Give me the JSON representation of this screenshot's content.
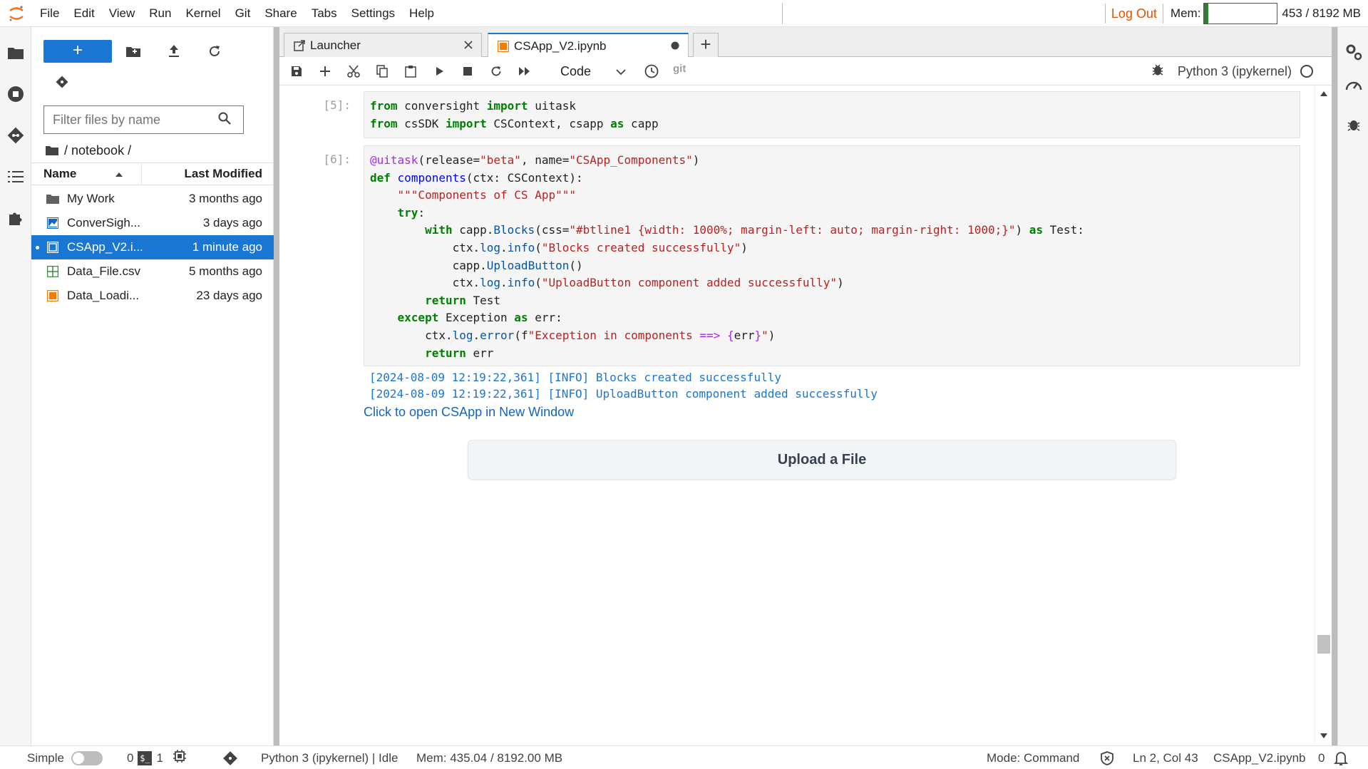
{
  "menubar": {
    "items": [
      "File",
      "Edit",
      "View",
      "Run",
      "Kernel",
      "Git",
      "Share",
      "Tabs",
      "Settings",
      "Help"
    ],
    "logout_label": "Log Out",
    "mem_label": "Mem:",
    "mem_text": "453 / 8192 MB",
    "mem_fraction": 0.055,
    "accent_color": "#e65100"
  },
  "filebrowser": {
    "new_button_label": "+",
    "filter_placeholder": "Filter files by name",
    "breadcrumb": "/ notebook /",
    "col_name": "Name",
    "col_modified": "Last Modified",
    "files": [
      {
        "name": "My Work",
        "modified": "3 months ago",
        "icon": "folder-icon",
        "selected": false
      },
      {
        "name": "ConverSigh...",
        "modified": "3 days ago",
        "icon": "image-icon",
        "selected": false
      },
      {
        "name": "CSApp_V2.i...",
        "modified": "1 minute ago",
        "icon": "notebook-icon",
        "selected": true
      },
      {
        "name": "Data_File.csv",
        "modified": "5 months ago",
        "icon": "spreadsheet-icon",
        "selected": false
      },
      {
        "name": "Data_Loadi...",
        "modified": "23 days ago",
        "icon": "notebook-icon",
        "selected": false
      }
    ]
  },
  "tabs": [
    {
      "label": "Launcher",
      "active": false
    },
    {
      "label": "CSApp_V2.ipynb",
      "active": true
    }
  ],
  "toolbar": {
    "cell_type": "Code",
    "git_label": "git",
    "kernel_name": "Python 3 (ipykernel)"
  },
  "cells": {
    "cell5_prompt": "[5]:",
    "cell6_prompt": "[6]:",
    "log_line_1": "[2024-08-09 12:19:22,361] [INFO] Blocks created successfully",
    "log_line_2": "[2024-08-09 12:19:22,361] [INFO] UploadButton component added successfully",
    "open_link": "Click to open CSApp in New Window",
    "upload_button": "Upload a File"
  },
  "statusbar": {
    "mode_label": "Simple",
    "count_a": "0",
    "count_b": "1",
    "kernel_status": "Python 3 (ipykernel) | Idle",
    "mem": "Mem: 435.04 / 8192.00 MB",
    "mode": "Mode: Command",
    "position": "Ln 2, Col 43",
    "filename": "CSApp_V2.ipynb",
    "notifications": "0"
  },
  "colors": {
    "brand_blue": "#1976d2",
    "orange": "#f57c00",
    "mem_green": "#2e7d32"
  }
}
